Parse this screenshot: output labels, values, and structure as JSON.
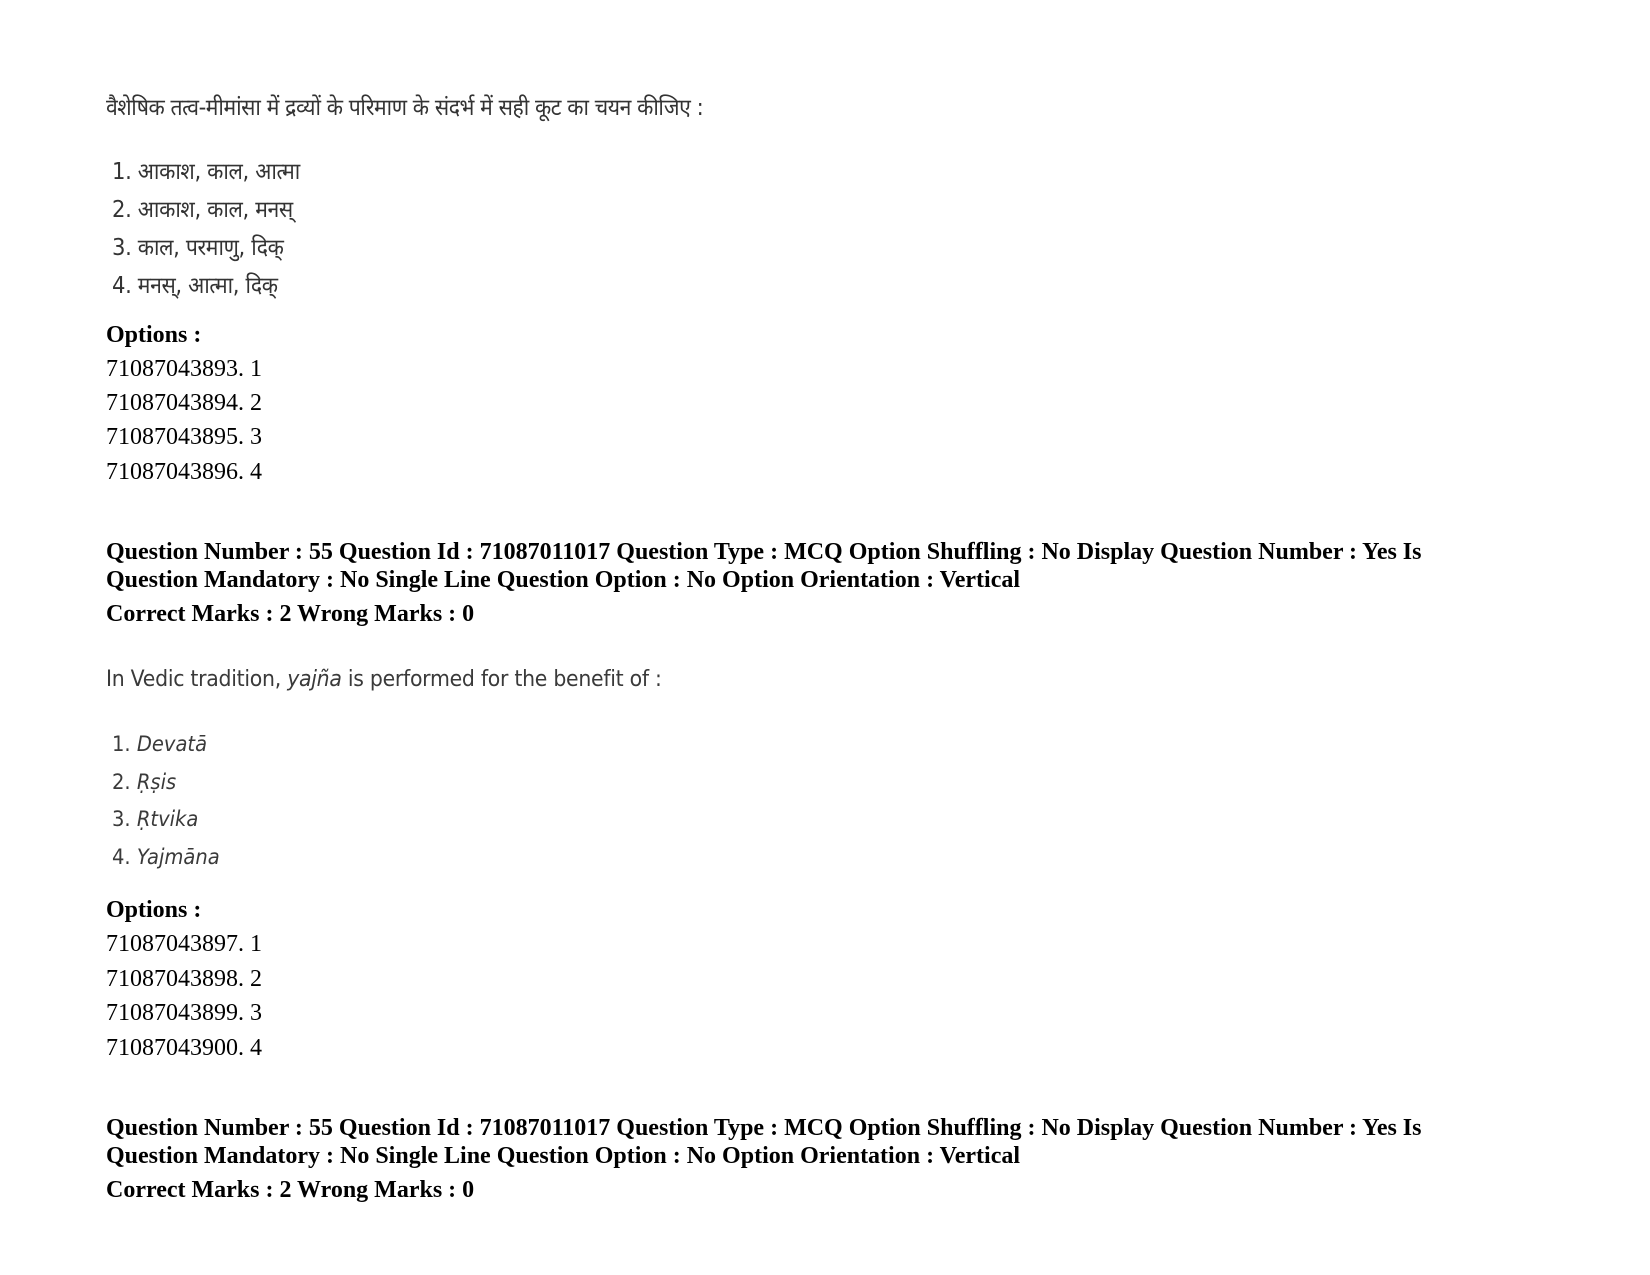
{
  "questions": [
    {
      "prompt": "वैशेषिक तत्व-मीमांसा में द्रव्यों के परिमाण के संदर्भ में सही कूट का चयन कीजिए :",
      "items": [
        "1. आकाश, काल, आत्मा",
        "2. आकाश, काल, मनस्",
        "3. काल, परमाणु, दिक्",
        "4. मनस्, आत्मा, दिक्"
      ],
      "options_label": "Options :",
      "options": [
        "71087043893. 1",
        "71087043894. 2",
        "71087043895. 3",
        "71087043896. 4"
      ]
    },
    {
      "meta_line1": "Question Number : 55 Question Id : 71087011017 Question Type : MCQ Option Shuffling : No Display Question Number : Yes Is",
      "meta_line2": "Question Mandatory : No Single Line Question Option : No Option Orientation : Vertical",
      "marks": "Correct Marks : 2 Wrong Marks : 0",
      "prompt_before": "In Vedic tradition, ",
      "prompt_italic": "yajña",
      "prompt_after": " is performed for the benefit of :",
      "items": [
        {
          "num": "1. ",
          "text": "Devatā"
        },
        {
          "num": "2. ",
          "text": "Ṛṣis"
        },
        {
          "num": "3. ",
          "text": "Ṛtvika"
        },
        {
          "num": "4. ",
          "text": "Yajmāna"
        }
      ],
      "options_label": "Options :",
      "options": [
        "71087043897. 1",
        "71087043898. 2",
        "71087043899. 3",
        "71087043900. 4"
      ]
    },
    {
      "meta_line1": "Question Number : 55 Question Id : 71087011017 Question Type : MCQ Option Shuffling : No Display Question Number : Yes Is",
      "meta_line2": "Question Mandatory : No Single Line Question Option : No Option Orientation : Vertical",
      "marks": "Correct Marks : 2 Wrong Marks : 0"
    }
  ]
}
